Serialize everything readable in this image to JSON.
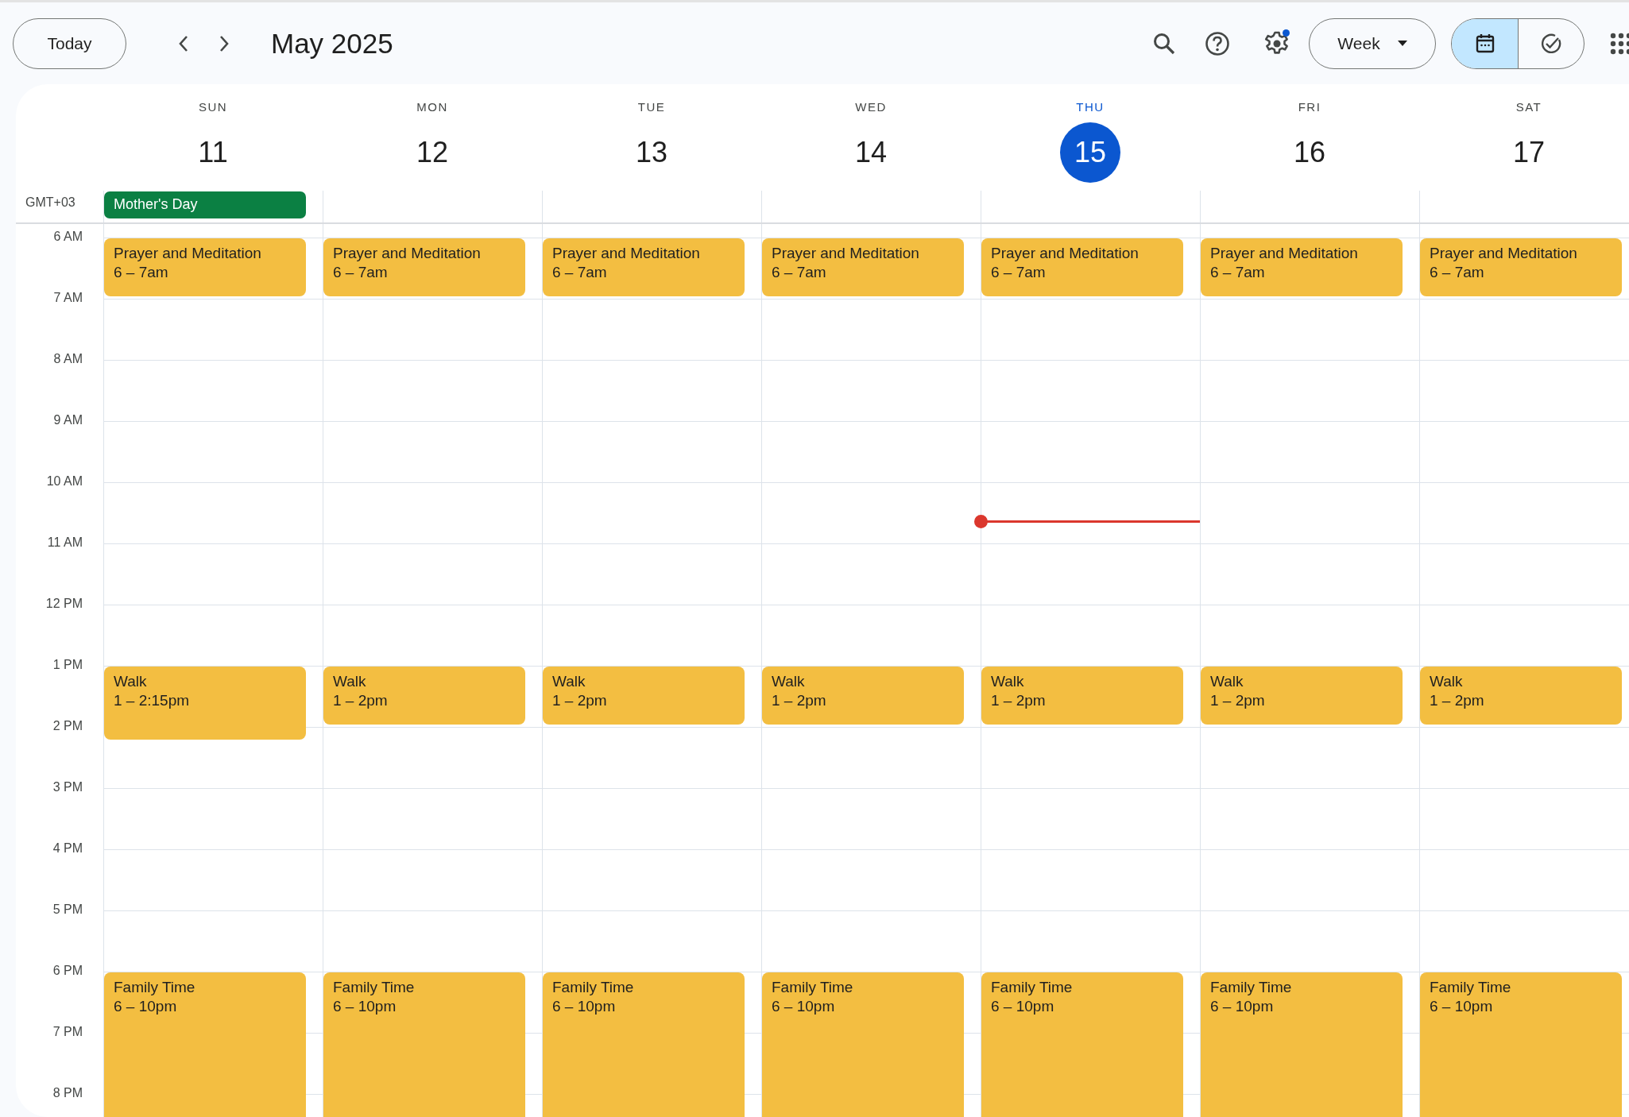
{
  "toolbar": {
    "today_button": "Today",
    "title": "May 2025",
    "settings": {
      "notification": true
    },
    "view_button": "Week",
    "view_toggle": [
      {
        "selected": true
      },
      {
        "selected": false
      }
    ]
  },
  "timezone": "GMT+03",
  "hours": [
    "6 AM",
    "7 AM",
    "8 AM",
    "9 AM",
    "10 AM",
    "11 AM",
    "12 PM",
    "1 PM",
    "2 PM",
    "3 PM",
    "4 PM",
    "5 PM",
    "6 PM",
    "7 PM",
    "8 PM"
  ],
  "days": [
    {
      "weekday": "SUN",
      "date": "11",
      "today": false,
      "all_day": [
        {
          "title": "Mother's Day"
        }
      ],
      "events": [
        {
          "kind": "prayer",
          "title": "Prayer and Meditation",
          "time": "6 – 7am"
        },
        {
          "kind": "walk_long",
          "title": "Walk",
          "time": "1 – 2:15pm"
        },
        {
          "kind": "family",
          "title": "Family Time",
          "time": "6 – 10pm"
        }
      ]
    },
    {
      "weekday": "MON",
      "date": "12",
      "today": false,
      "events": [
        {
          "kind": "prayer",
          "title": "Prayer and Meditation",
          "time": "6 – 7am"
        },
        {
          "kind": "walk",
          "title": "Walk",
          "time": "1 – 2pm"
        },
        {
          "kind": "family",
          "title": "Family Time",
          "time": "6 – 10pm"
        }
      ]
    },
    {
      "weekday": "TUE",
      "date": "13",
      "today": false,
      "events": [
        {
          "kind": "prayer",
          "title": "Prayer and Meditation",
          "time": "6 – 7am"
        },
        {
          "kind": "walk",
          "title": "Walk",
          "time": "1 – 2pm"
        },
        {
          "kind": "family",
          "title": "Family Time",
          "time": "6 – 10pm"
        }
      ]
    },
    {
      "weekday": "WED",
      "date": "14",
      "today": false,
      "events": [
        {
          "kind": "prayer",
          "title": "Prayer and Meditation",
          "time": "6 – 7am"
        },
        {
          "kind": "walk",
          "title": "Walk",
          "time": "1 – 2pm"
        },
        {
          "kind": "family",
          "title": "Family Time",
          "time": "6 – 10pm"
        }
      ]
    },
    {
      "weekday": "THU",
      "date": "15",
      "today": true,
      "events": [
        {
          "kind": "prayer",
          "title": "Prayer and Meditation",
          "time": "6 – 7am"
        },
        {
          "kind": "walk",
          "title": "Walk",
          "time": "1 – 2pm"
        },
        {
          "kind": "family",
          "title": "Family Time",
          "time": "6 – 10pm"
        }
      ]
    },
    {
      "weekday": "FRI",
      "date": "16",
      "today": false,
      "events": [
        {
          "kind": "prayer",
          "title": "Prayer and Meditation",
          "time": "6 – 7am"
        },
        {
          "kind": "walk",
          "title": "Walk",
          "time": "1 – 2pm"
        },
        {
          "kind": "family",
          "title": "Family Time",
          "time": "6 – 10pm"
        }
      ]
    },
    {
      "weekday": "SAT",
      "date": "17",
      "today": false,
      "events": [
        {
          "kind": "prayer",
          "title": "Prayer and Meditation",
          "time": "6 – 7am"
        },
        {
          "kind": "walk",
          "title": "Walk",
          "time": "1 – 2pm"
        },
        {
          "kind": "family",
          "title": "Family Time",
          "time": "6 – 10pm"
        }
      ]
    }
  ]
}
